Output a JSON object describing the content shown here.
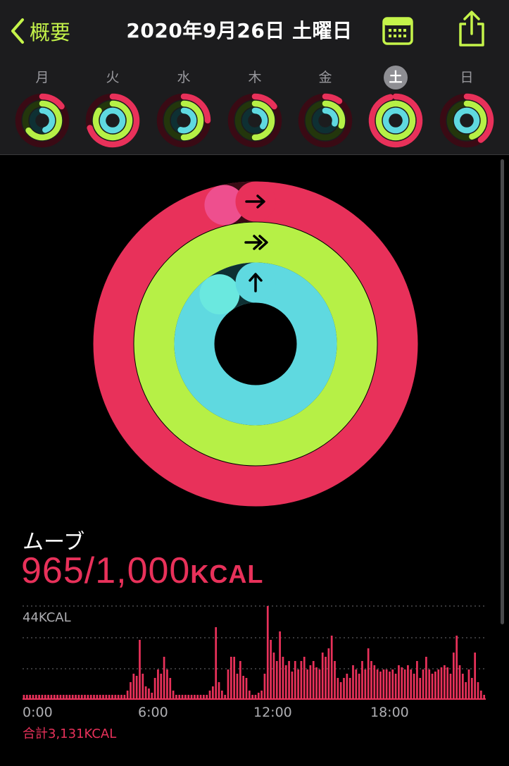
{
  "nav": {
    "back_label": "概要",
    "title": "2020年9月26日 土曜日"
  },
  "colors": {
    "move": "#e8315a",
    "move_end": "#ee4f8e",
    "exercise": "#b6f046",
    "stand": "#5fd9e0",
    "accent": "#c5f44a"
  },
  "icons": {
    "back": "chevron-left-icon",
    "calendar": "calendar-icon",
    "share": "share-icon"
  },
  "week": [
    {
      "label": "月",
      "move": 0.15,
      "exercise": 0.65,
      "stand": 0.45,
      "selected": false
    },
    {
      "label": "火",
      "move": 0.7,
      "exercise": 0.85,
      "stand": 1.0,
      "selected": false
    },
    {
      "label": "水",
      "move": 0.25,
      "exercise": 0.5,
      "stand": 0.55,
      "selected": false
    },
    {
      "label": "木",
      "move": 0.15,
      "exercise": 0.5,
      "stand": 0.35,
      "selected": false
    },
    {
      "label": "金",
      "move": 0.1,
      "exercise": 0.3,
      "stand": 0.3,
      "selected": false
    },
    {
      "label": "土",
      "move": 0.965,
      "exercise": 1.05,
      "stand": 1.0,
      "selected": true
    },
    {
      "label": "日",
      "move": 0.4,
      "exercise": 0.45,
      "stand": 1.0,
      "selected": false
    }
  ],
  "rings": {
    "move": 0.965,
    "exercise": 1.05,
    "stand": 0.9
  },
  "move": {
    "label": "ムーブ",
    "value": "965/1,000",
    "unit": "KCAL"
  },
  "chart_data": {
    "type": "bar",
    "ymax_label": "44KCAL",
    "ymax": 44,
    "x_labels": [
      "0:00",
      "6:00",
      "12:00",
      "18:00"
    ],
    "total_label": "合計3,131KCAL",
    "values": [
      2,
      2,
      2,
      2,
      2,
      2,
      2,
      2,
      2,
      2,
      2,
      2,
      2,
      2,
      2,
      2,
      2,
      2,
      2,
      2,
      2,
      2,
      2,
      2,
      2,
      2,
      2,
      2,
      2,
      2,
      2,
      2,
      2,
      2,
      4,
      8,
      12,
      11,
      28,
      12,
      6,
      5,
      3,
      10,
      14,
      12,
      20,
      14,
      10,
      4,
      2,
      2,
      2,
      2,
      2,
      2,
      2,
      2,
      2,
      2,
      2,
      4,
      6,
      34,
      8,
      4,
      2,
      14,
      20,
      20,
      12,
      18,
      11,
      10,
      4,
      2,
      2,
      3,
      4,
      12,
      44,
      28,
      22,
      18,
      32,
      20,
      16,
      18,
      13,
      18,
      14,
      18,
      20,
      14,
      16,
      18,
      15,
      14,
      22,
      20,
      24,
      30,
      18,
      10,
      8,
      10,
      12,
      10,
      16,
      14,
      12,
      18,
      14,
      24,
      18,
      16,
      14,
      13,
      14,
      14,
      13,
      14,
      12,
      16,
      15,
      14,
      16,
      14,
      12,
      18,
      10,
      14,
      20,
      14,
      12,
      13,
      14,
      15,
      16,
      15,
      12,
      22,
      30,
      16,
      12,
      8,
      14,
      10,
      22,
      8,
      4,
      2
    ]
  }
}
